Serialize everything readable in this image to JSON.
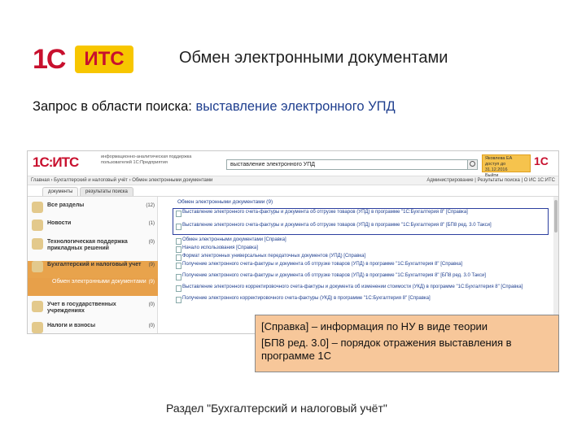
{
  "logo": {
    "red": "1С",
    "yellow": "ИТС"
  },
  "slide": {
    "title": "Обмен электронными документами",
    "query_label": "Запрос в области поиска:",
    "query_value": "выставление электронного УПД"
  },
  "screenshot": {
    "logo_text": "1С:ИТС",
    "subtitle": "информационно-аналитическая поддержка пользователей 1С:Предприятия",
    "search_value": "выставление электронного УПД",
    "user_name": "Яковлева ЕА",
    "user_date": "доступ до 31.12.2016",
    "user_exit": "Выйти",
    "nav_left": "Главная › Бухгалтерский и налоговый учёт › Обмен электронными документами",
    "nav_right": "Администрирование | Результаты поиска | О ИС 1С:ИТС",
    "tabs": [
      "документы",
      "результаты поиска"
    ],
    "sections": [
      {
        "label": "Все разделы",
        "count": "(12)"
      },
      {
        "label": "Новости",
        "count": "(1)"
      },
      {
        "label": "Технологическая поддержка прикладных решений",
        "count": "(0)"
      },
      {
        "label": "Бухгалтерский и налоговый учет",
        "count": "(9)"
      },
      {
        "label": "Обмен электронными документами",
        "count": "(9)"
      },
      {
        "label": "Учет в государственных учреждениях",
        "count": "(0)"
      },
      {
        "label": "Налоги и взносы",
        "count": "(0)"
      }
    ],
    "root": "Обмен электронными документами (9)",
    "results": [
      "Выставление электронного счета-фактуры и документа об отгрузке товаров (УПД) в программе \"1С:Бухгалтерия 8\" [Справка]",
      "Выставление электронного счета-фактуры и документа об отгрузке товаров (УПД) в программе \"1С:Бухгалтерия 8\" [БП8 ред. 3.0 Такси]",
      "Обмен электронными документами [Справка]",
      "Начало использования [Справка]",
      "Формат электронных универсальных передаточных документов (УПД) [Справка]",
      "Получение электронного счета-фактуры и документа об отгрузке товаров (УПД) в программе \"1С:Бухгалтерия 8\" [Справка]",
      "Получение электронного счета-фактуры и документа об отгрузке товаров (УПД) в программе \"1С:Бухгалтерия 8\" [БП8 ред. 3.0 Такси]",
      "Выставление электронного корректировочного счета-фактуры и документа об изменении стоимости (УКД) в программе \"1С:Бухгалтерия 8\" [Справка]",
      "Получение электронного корректировочного счета-фактуры (УКД) в программе \"1С:Бухгалтерия 8\" [Справка]"
    ]
  },
  "callout": {
    "line1": "[Справка] – информация по НУ в виде теории",
    "line2": "[БП8 ред. 3.0] – порядок отражения выставления в программе 1С"
  },
  "footer": "Раздел \"Бухгалтерский и налоговый учёт\""
}
